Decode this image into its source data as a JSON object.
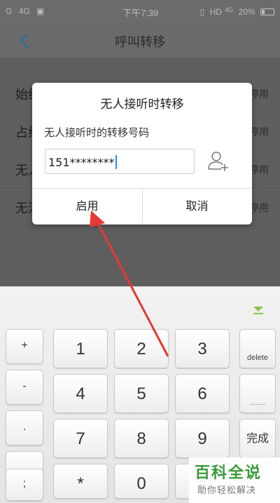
{
  "status_bar": {
    "signal_1": "G",
    "network_2": "4G",
    "time": "下午7:39",
    "network_right": "HD",
    "network_right_sup": "4G",
    "battery": "20%"
  },
  "header": {
    "title": "呼叫转移"
  },
  "settings": [
    {
      "label": "始终",
      "status": "停用"
    },
    {
      "label": "占线",
      "status": "停用"
    },
    {
      "label": "无人",
      "status": "停用"
    },
    {
      "label": "无法",
      "status": "停用"
    }
  ],
  "dialog": {
    "title": "无人接听时转移",
    "description": "无人接听时的转移号码",
    "number_value": "151********",
    "enable_label": "启用",
    "cancel_label": "取消"
  },
  "keyboard": {
    "side_keys": [
      "+",
      "-",
      ".",
      ",",
      ";"
    ],
    "number_keys": [
      "1",
      "2",
      "3",
      "4",
      "5",
      "6",
      "7",
      "8",
      "9",
      "*",
      "0",
      "#"
    ],
    "delete_label": "delete",
    "done_label": "完成"
  },
  "watermark": {
    "title": "百科全说",
    "subtitle": "助你轻松解决"
  },
  "colors": {
    "accent_arrow": "#e53935",
    "caret": "#1e88ff",
    "collapse_indicator": "#8bc34a",
    "watermark_green": "#3a9a3a"
  }
}
